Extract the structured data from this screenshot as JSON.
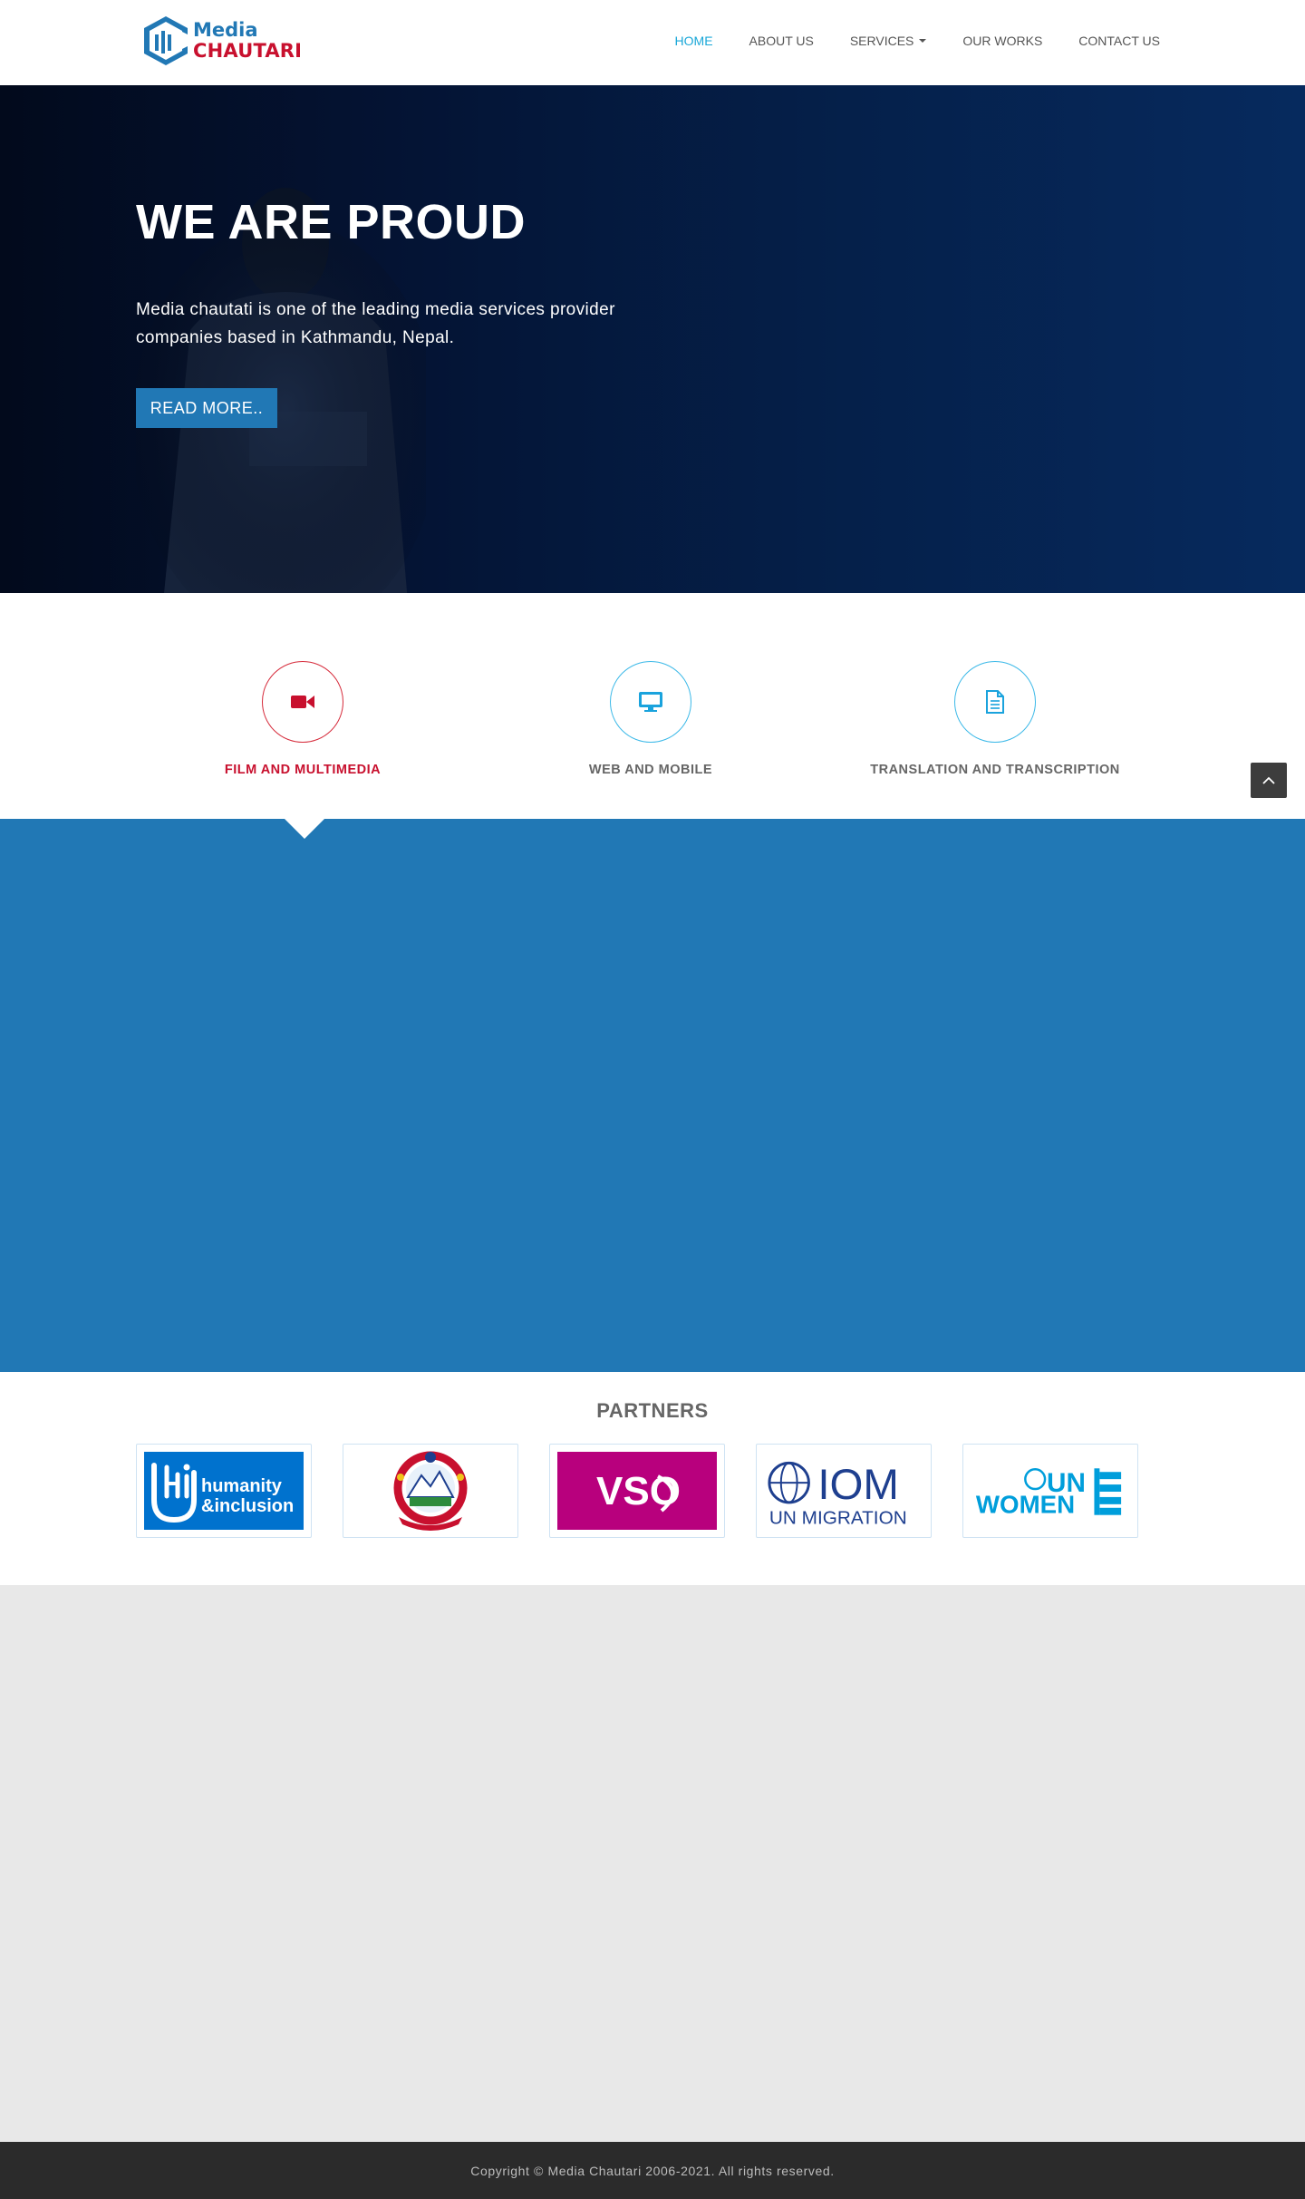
{
  "header": {
    "logo": {
      "line1": "Media",
      "line2": "CHAUTARI"
    },
    "nav": [
      {
        "label": "HOME",
        "active": true
      },
      {
        "label": "ABOUT US"
      },
      {
        "label": "SERVICES",
        "dropdown": true
      },
      {
        "label": "OUR WORKS"
      },
      {
        "label": "CONTACT US"
      }
    ]
  },
  "hero": {
    "title": "WE ARE PROUD",
    "text": "Media chautati is one of the leading media services provider companies based in Kathmandu, Nepal.",
    "button": "READ MORE.."
  },
  "services": [
    {
      "label": "FILM AND MULTIMEDIA",
      "icon": "video-camera-icon",
      "active": true
    },
    {
      "label": "WEB AND MOBILE",
      "icon": "monitor-icon"
    },
    {
      "label": "TRANSLATION AND TRANSCRIPTION",
      "icon": "document-icon"
    }
  ],
  "partners": {
    "title": "PARTNERS",
    "logos": [
      {
        "name": "humanity-inclusion-logo",
        "text_line1": "humanity",
        "text_line2": "&inclusion",
        "mark": "Hi",
        "color": "#0072ce"
      },
      {
        "name": "nepal-government-emblem-logo",
        "color": "#c8102e"
      },
      {
        "name": "vso-logo",
        "text": "VSO",
        "color": "#b8007d"
      },
      {
        "name": "iom-logo",
        "text_line1": "IOM",
        "text_line2": "UN MIGRATION",
        "color": "#1e3f8f"
      },
      {
        "name": "un-women-logo",
        "text_line1": "UN",
        "text_line2": "WOMEN",
        "color": "#009edb"
      }
    ]
  },
  "colors": {
    "brand_blue": "#2178b5",
    "brand_red": "#c8102e",
    "nav_active": "#19a7d8",
    "footer_bg": "#2b2b2b"
  },
  "footer": {
    "copyright": "Copyright © Media Chautari 2006-2021. All rights reserved."
  }
}
